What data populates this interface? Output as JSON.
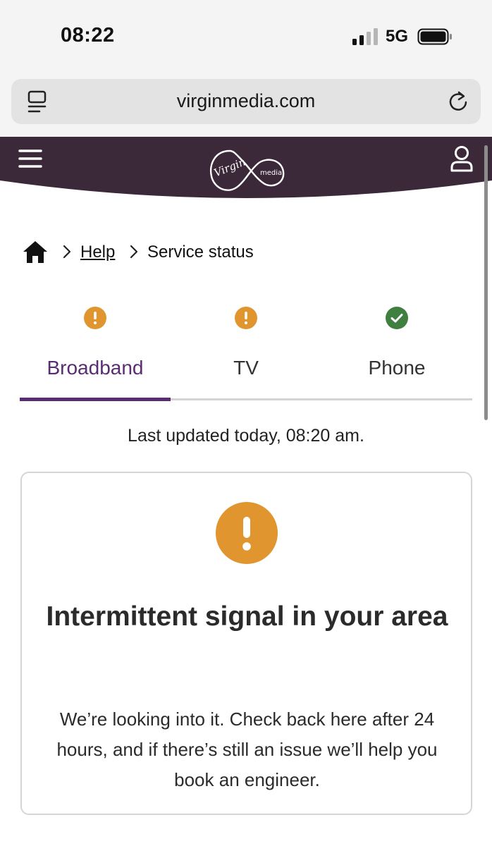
{
  "status_bar": {
    "time": "08:22",
    "network": "5G",
    "icons": [
      "signal-bars-icon",
      "battery-icon"
    ]
  },
  "browser": {
    "url": "virginmedia.com",
    "icons": [
      "reader-mode-icon",
      "reload-icon"
    ]
  },
  "header": {
    "brand_color": "#3b2838",
    "icons": [
      "hamburger-menu-icon",
      "virgin-media-logo",
      "account-icon"
    ],
    "logo_text": {
      "virgin": "Virgin",
      "media": "media"
    }
  },
  "breadcrumb": {
    "home_icon": "home-icon",
    "items": [
      "Help",
      "Service status"
    ]
  },
  "tabs": [
    {
      "label": "Broadband",
      "status": "warning",
      "icon": "warning-icon",
      "active": true
    },
    {
      "label": "TV",
      "status": "warning",
      "icon": "warning-icon",
      "active": false
    },
    {
      "label": "Phone",
      "status": "ok",
      "icon": "check-icon",
      "active": false
    }
  ],
  "last_updated": "Last updated today, 08:20 am.",
  "status_card": {
    "icon": "warning-icon",
    "title": "Intermittent signal in your area",
    "body": "We’re looking into it. Check back here after 24 hours, and if there’s still an issue we’ll help you book an engineer."
  },
  "colors": {
    "accent": "#5a2d72",
    "warning": "#e0952f",
    "ok": "#3f7f3f",
    "header": "#3b2838"
  }
}
